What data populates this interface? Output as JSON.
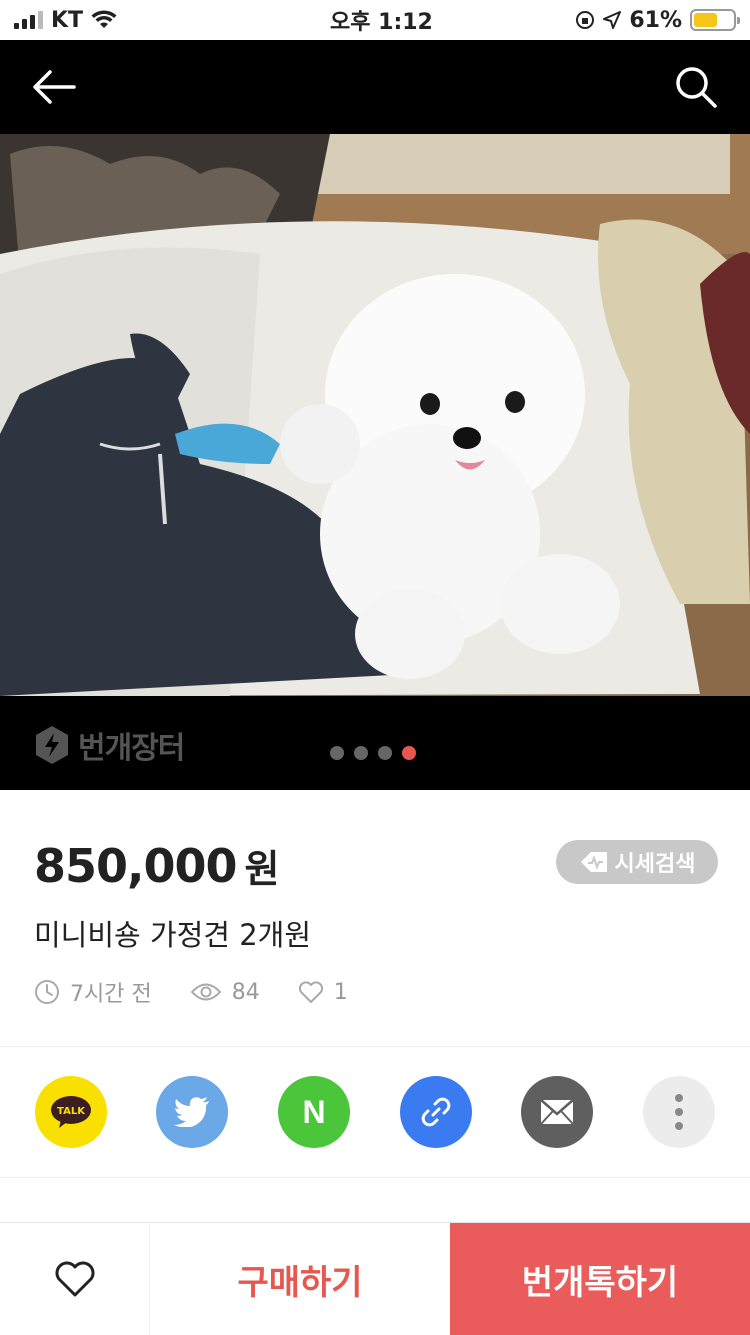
{
  "status_bar": {
    "carrier": "KT",
    "time": "오후 1:12",
    "battery_percent": "61%"
  },
  "nav": {
    "back_icon": "arrow-left-icon",
    "search_icon": "search-icon"
  },
  "gallery": {
    "watermark": "번개장터",
    "image_count": 4,
    "active_index": 3
  },
  "product": {
    "price": "850,000",
    "currency": "원",
    "price_search_label": "시세검색",
    "title": "미니비숑 가정견 2개원",
    "time_ago": "7시간 전",
    "views": "84",
    "likes": "1"
  },
  "share": {
    "items": [
      {
        "name": "kakaotalk",
        "label": "TALK",
        "color": "#f9e000"
      },
      {
        "name": "twitter",
        "color": "#6aa8e8"
      },
      {
        "name": "naver",
        "label": "N",
        "color": "#4bc63a"
      },
      {
        "name": "copy-link",
        "color": "#3b7bf2"
      },
      {
        "name": "email",
        "color": "#5f5f5f"
      },
      {
        "name": "more",
        "color": "#ececec"
      }
    ]
  },
  "actions": {
    "buy_label": "구매하기",
    "chat_label": "번개톡하기",
    "accent_color": "#ea5c5c"
  }
}
